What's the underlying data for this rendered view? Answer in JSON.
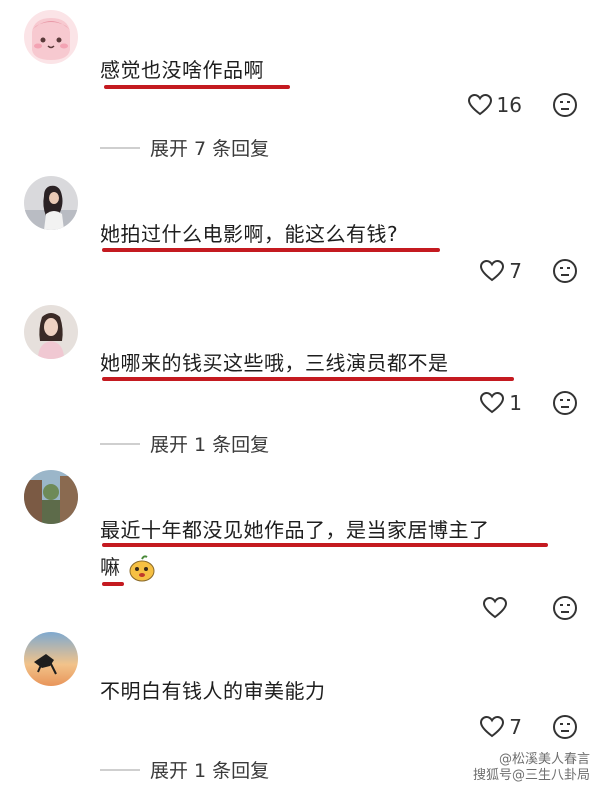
{
  "comments": [
    {
      "text": "感觉也没啥作品啊",
      "likes": "16",
      "reply_toggle": "展开 7 条回复",
      "avatar": "pink-cartoon-avatar"
    },
    {
      "text": "她拍过什么电影啊，能这么有钱?",
      "likes": "7",
      "reply_toggle": "",
      "avatar": "woman-photo-avatar"
    },
    {
      "text": "她哪来的钱买这些哦，三线演员都不是",
      "likes": "1",
      "reply_toggle": "展开 1 条回复",
      "avatar": "woman-portrait-avatar"
    },
    {
      "text_line1": "最近十年都没见她作品了，是当家居博主了",
      "text_line2": "嘛",
      "likes": "",
      "reply_toggle": "",
      "avatar": "street-photo-avatar"
    },
    {
      "text": "不明白有钱人的审美能力",
      "likes": "7",
      "reply_toggle": "展开 1 条回复",
      "avatar": "sunset-silhouette-avatar"
    }
  ],
  "watermark": {
    "line1": "@松溪美人春言",
    "line2": "搜狐号@三生八卦局"
  },
  "colors": {
    "underline": "#c41a20",
    "text": "#1e1e1e",
    "icon": "#333333"
  }
}
